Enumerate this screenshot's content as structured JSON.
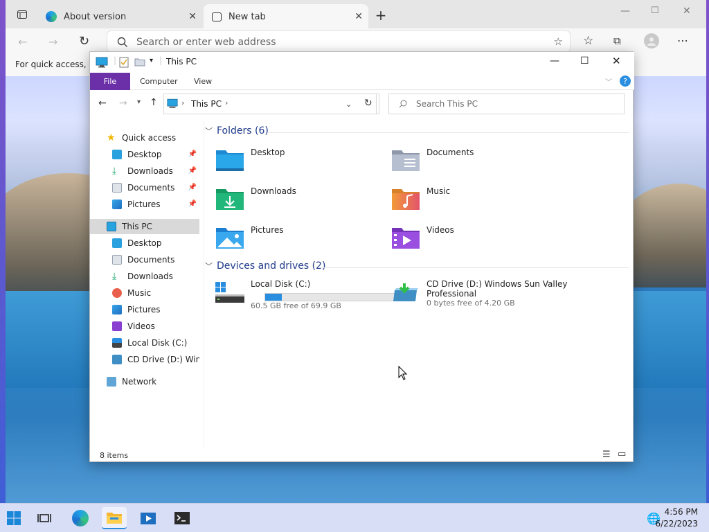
{
  "browser": {
    "tabs": [
      {
        "label": "About version",
        "active": false
      },
      {
        "label": "New tab",
        "active": true
      }
    ],
    "new_tab": "+",
    "address_placeholder": "Search or enter web address",
    "favorites_hint": "For quick access, pla"
  },
  "explorer": {
    "title": "This PC",
    "ribbon_tabs": [
      "File",
      "Computer",
      "View"
    ],
    "breadcrumb": "This PC",
    "search_placeholder": "Search This PC",
    "nav": {
      "quick_access": "Quick access",
      "quick_items": [
        "Desktop",
        "Downloads",
        "Documents",
        "Pictures"
      ],
      "this_pc": "This PC",
      "pc_items": [
        "Desktop",
        "Documents",
        "Downloads",
        "Music",
        "Pictures",
        "Videos",
        "Local Disk (C:)",
        "CD Drive (D:) Windo"
      ],
      "network": "Network"
    },
    "folders_header": "Folders (6)",
    "folders": [
      "Desktop",
      "Documents",
      "Downloads",
      "Music",
      "Pictures",
      "Videos"
    ],
    "drives_header": "Devices and drives (2)",
    "drives": [
      {
        "name": "Local Disk (C:)",
        "free": "60.5 GB free of 69.9 GB",
        "used_fraction": 0.13
      },
      {
        "name": "CD Drive (D:) Windows Sun Valley",
        "name2": "Professional",
        "free": "0 bytes free of 4.20 GB"
      }
    ],
    "status": "8 items"
  },
  "taskbar": {
    "time": "4:56 PM",
    "date": "6/22/2023"
  },
  "colors": {
    "file_tab": "#6b2fa8",
    "accent": "#2a8ee0",
    "header_text": "#1f3a8a"
  }
}
